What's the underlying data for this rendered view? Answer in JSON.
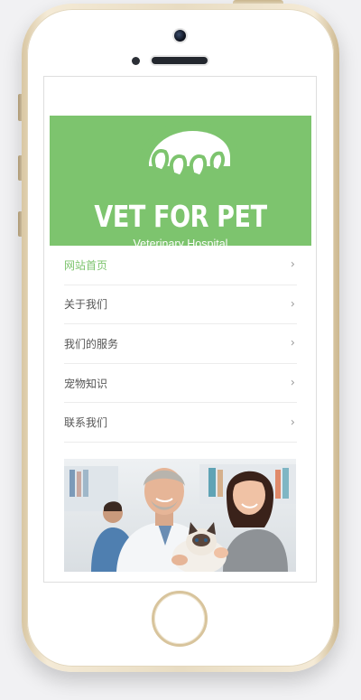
{
  "brand": {
    "title": "VET FOR PET",
    "subtitle": "Veterinary Hospital",
    "accent": "#7dc46e"
  },
  "menu": {
    "items": [
      {
        "label": "网站首页",
        "active": true,
        "icon": "chevron-right-icon"
      },
      {
        "label": "关于我们",
        "active": false,
        "icon": "chevron-right-icon"
      },
      {
        "label": "我们的服务",
        "active": false,
        "icon": "chevron-right-icon"
      },
      {
        "label": "宠物知识",
        "active": false,
        "icon": "chevron-right-icon"
      },
      {
        "label": "联系我们",
        "active": false,
        "icon": "chevron-right-icon"
      }
    ],
    "chevron": "›"
  },
  "photo": {
    "subject": "veterinarians-with-cat-photo"
  }
}
